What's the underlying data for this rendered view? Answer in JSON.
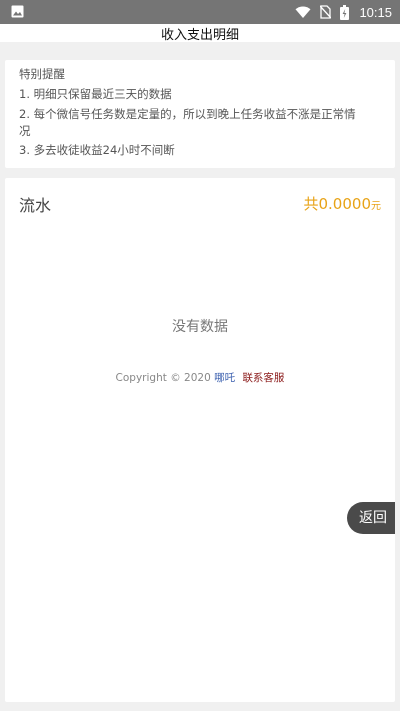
{
  "status_bar": {
    "time": "10:15",
    "icons": [
      "image-icon",
      "wifi-icon",
      "no-sim-icon",
      "battery-icon"
    ],
    "background": "#757575"
  },
  "header": {
    "title": "收入支出明细"
  },
  "notice": {
    "heading": "特别提醒",
    "lines": [
      "1. 明细只保留最近三天的数据",
      "2. 每个微信号任务数是定量的，所以到晚上任务收益不涨是正常情",
      "况",
      "3. 多去收徒收益24小时不间断"
    ]
  },
  "flow": {
    "title": "流水",
    "total_prefix": "共",
    "total_value": "0.0000",
    "total_unit": "元",
    "empty_text": "没有数据",
    "accent_color": "#e8a317"
  },
  "footer": {
    "copyright": "Copyright © 2020",
    "brand": "哪吒",
    "service": "联系客服"
  },
  "back_button": {
    "label": "返回"
  }
}
